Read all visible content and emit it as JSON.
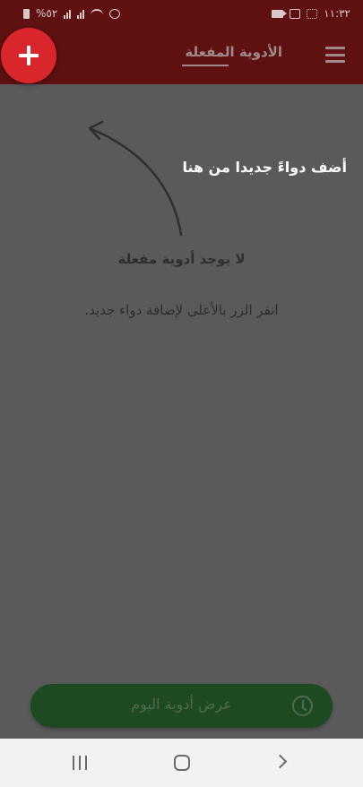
{
  "status_bar": {
    "time": "١١:٣٢",
    "battery": "%٥٢"
  },
  "app_bar": {
    "tab_title": "الأدوية المفعلة",
    "icons": {
      "menu": "menu-icon",
      "add": "plus-icon"
    }
  },
  "main": {
    "hint": "أضف دواءً جديدا من هنا",
    "empty_title": "لا يوجد أدوية مفعلة",
    "empty_subtitle": "انقر الزر بالأعلى لإضافة دواء جديد."
  },
  "bottom": {
    "today_button_label": "عرض أدوية اليوم",
    "icon": "clock-icon"
  },
  "colors": {
    "app_bar": "#5f1010",
    "fab": "#d9262d",
    "overlay": "#5a5a5a",
    "today_button": "#1d4a20"
  }
}
